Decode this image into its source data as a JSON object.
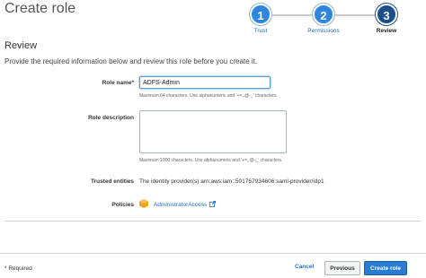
{
  "page": {
    "title": "Create role"
  },
  "stepper": {
    "steps": [
      {
        "number": "1",
        "label": "Trust"
      },
      {
        "number": "2",
        "label": "Permissions"
      },
      {
        "number": "3",
        "label": "Review"
      }
    ],
    "active_step": 3
  },
  "review": {
    "heading": "Review",
    "intro": "Provide the required information below and review this role before you create it."
  },
  "form": {
    "role_name": {
      "label": "Role name*",
      "value": "ADFS-Admin",
      "hint": "Maximum 64 characters. Use alphanumeric and '+=,.@-_' characters."
    },
    "role_description": {
      "label": "Role description",
      "value": "",
      "hint": "Maximum 1000 characters. Use alphanumeric and '+=,.@-_' characters."
    },
    "trusted_entities": {
      "label": "Trusted entities",
      "value": "The identity provider(s) arn:aws:iam::501767934606:saml-provider/idp1"
    },
    "policies": {
      "label": "Policies",
      "link": "AdministratorAccess"
    }
  },
  "footer": {
    "required_note": "* Required",
    "cancel_label": "Cancel",
    "previous_label": "Previous",
    "create_label": "Create role"
  },
  "colors": {
    "accent": "#2b7bd1",
    "step_active": "#1a4f8a",
    "link": "#1f6fbf",
    "policy_icon": "#f2a51c"
  },
  "icons": {
    "policy": "policy-cube-icon",
    "external": "external-link-icon"
  }
}
